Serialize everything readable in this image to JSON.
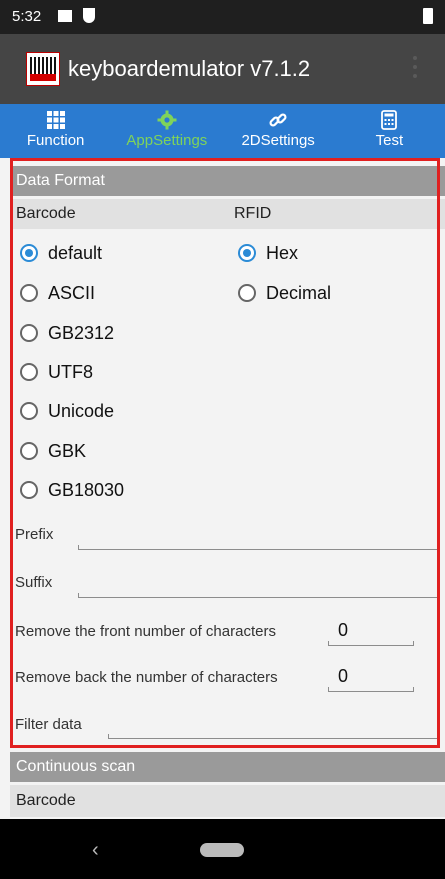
{
  "status_bar": {
    "time": "5:32"
  },
  "app_bar": {
    "title": "keyboardemulator v7.1.2"
  },
  "tabs": [
    {
      "label": "Function",
      "icon": "grid-icon"
    },
    {
      "label": "AppSettings",
      "icon": "gear-icon",
      "active": true
    },
    {
      "label": "2DSettings",
      "icon": "link-icon"
    },
    {
      "label": "Test",
      "icon": "calculator-icon"
    }
  ],
  "data_format": {
    "header": "Data Format",
    "barcode_label": "Barcode",
    "rfid_label": "RFID",
    "barcode_options": [
      "default",
      "ASCII",
      "GB2312",
      "UTF8",
      "Unicode",
      "GBK",
      "GB18030"
    ],
    "barcode_selected": "default",
    "rfid_options": [
      "Hex",
      "Decimal"
    ],
    "rfid_selected": "Hex",
    "prefix_label": "Prefix",
    "suffix_label": "Suffix",
    "remove_front_label": "Remove the front number of characters",
    "remove_front_value": "0",
    "remove_back_label": "Remove back the number of characters",
    "remove_back_value": "0",
    "filter_label": "Filter data"
  },
  "continuous_scan": {
    "header": "Continuous scan",
    "barcode_label": "Barcode"
  },
  "colors": {
    "tab_bar": "#2b7bd0",
    "active_tab": "#7fd35a",
    "radio_checked": "#2b8bd6",
    "highlight_frame": "#e02020"
  }
}
